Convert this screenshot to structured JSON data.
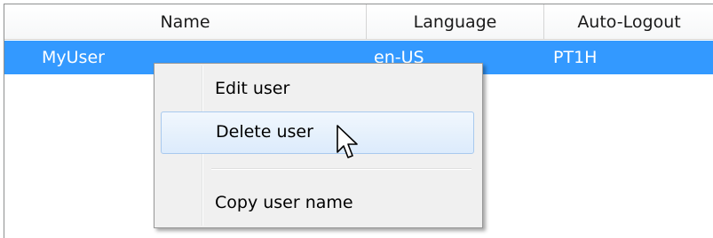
{
  "table": {
    "columns": [
      "Name",
      "Language",
      "Auto-Logout"
    ],
    "rows": [
      {
        "name": "MyUser",
        "language": "en-US",
        "auto_logout": "PT1H"
      }
    ]
  },
  "context_menu": {
    "items": [
      {
        "label": "Edit user"
      },
      {
        "label": "Delete user"
      },
      {
        "label": "Copy user name"
      }
    ],
    "hovered_item": "Delete user"
  },
  "colors": {
    "selection": "#3399ff",
    "menu_background": "#f0f0f0",
    "hover_border": "#a8c9ee"
  },
  "icons": {
    "cursor": "mouse-pointer-icon"
  }
}
